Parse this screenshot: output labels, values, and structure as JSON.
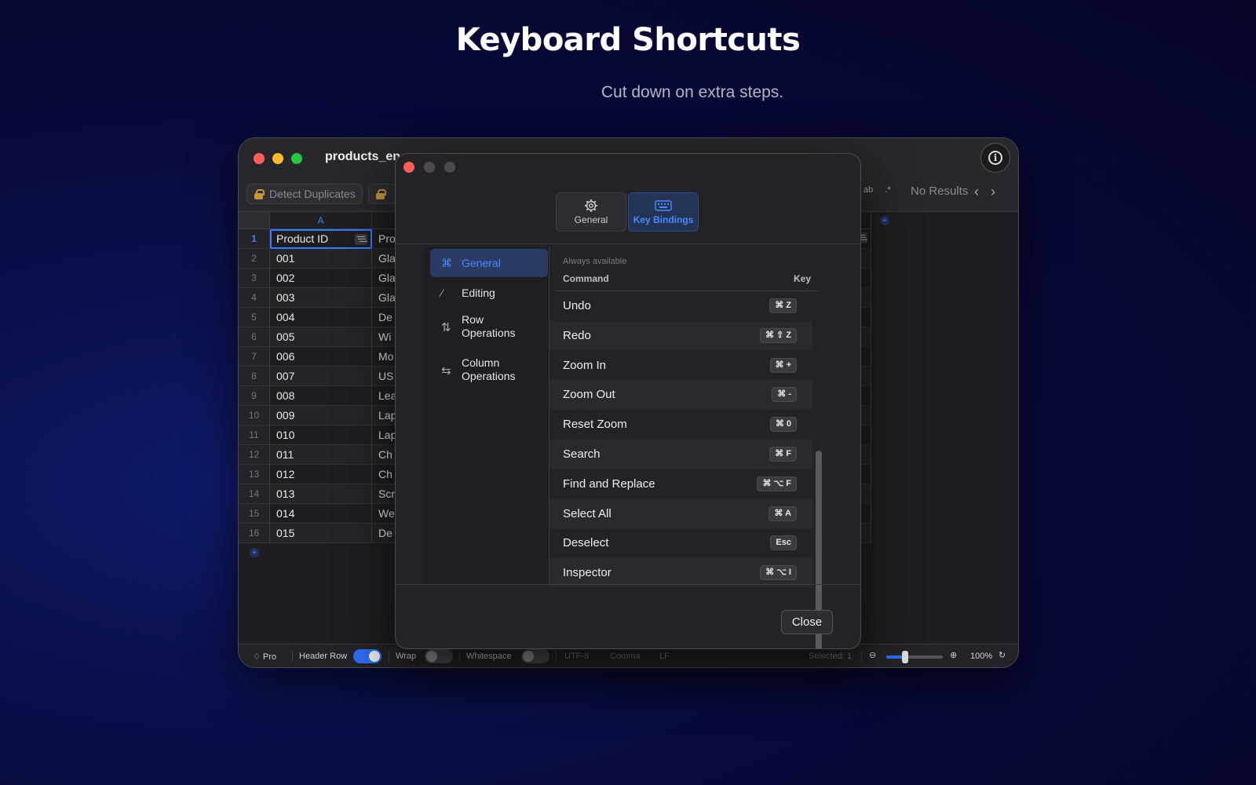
{
  "hero": {
    "title": "Keyboard Shortcuts",
    "subtitle": "Cut down on extra steps."
  },
  "window": {
    "title": "products_en",
    "toolbar": {
      "detect_duplicates": "Detect Duplicates",
      "search_opt_case": "ab",
      "search_opt_regex": ".*",
      "no_results": "No Results"
    },
    "grid": {
      "col_a": "A",
      "header_row": [
        "Product ID",
        "Pro"
      ],
      "row_numbers": [
        "1",
        "2",
        "3",
        "4",
        "5",
        "6",
        "7",
        "8",
        "9",
        "10",
        "11",
        "12",
        "13",
        "14",
        "15",
        "16"
      ],
      "ids": [
        "001",
        "002",
        "003",
        "004",
        "005",
        "006",
        "007",
        "008",
        "009",
        "010",
        "011",
        "012",
        "013",
        "014",
        "015"
      ],
      "col_b": [
        "Gla",
        "Gla",
        "Gla",
        "De",
        "Wi",
        "Mo",
        "US",
        "Lea",
        "Lap",
        "Lap",
        "Ch",
        "Ch",
        "Scr",
        "We",
        "De"
      ]
    },
    "statusbar": {
      "pro": "Pro",
      "header_row": "Header Row",
      "header_row_on": true,
      "wrap": "Wrap",
      "wrap_on": false,
      "whitespace": "Whitespace",
      "whitespace_on": false,
      "encoding": "UTF-8",
      "delimiter": "Comma",
      "line_ending": "LF",
      "selected": "Selected: 1",
      "zoom": "100%",
      "zoom_slider_fraction": 0.33
    }
  },
  "dialog": {
    "tabs": [
      {
        "label": "General",
        "icon": "gear-icon",
        "active": false
      },
      {
        "label": "Key Bindings",
        "icon": "keyboard-icon",
        "active": true
      }
    ],
    "sidebar": [
      {
        "label": "General",
        "icon": "command-icon",
        "glyph": "⌘",
        "active": true
      },
      {
        "label": "Editing",
        "icon": "pencil-icon",
        "glyph": "∕",
        "active": false
      },
      {
        "label": "Row Operations",
        "label_line1": "Row",
        "label_line2": "Operations",
        "icon": "vertical-arrows-icon",
        "glyph": "⇅",
        "active": false
      },
      {
        "label": "Column Operations",
        "label_line1": "Column",
        "label_line2": "Operations",
        "icon": "horizontal-arrows-icon",
        "glyph": "⇆",
        "active": false
      }
    ],
    "section_label": "Always available",
    "column_command": "Command",
    "column_key": "Key",
    "bindings": [
      {
        "command": "Undo",
        "key": "⌘ Z"
      },
      {
        "command": "Redo",
        "key": "⌘ ⇧ Z"
      },
      {
        "command": "Zoom In",
        "key": "⌘ +"
      },
      {
        "command": "Zoom Out",
        "key": "⌘ -"
      },
      {
        "command": "Reset Zoom",
        "key": "⌘ 0"
      },
      {
        "command": "Search",
        "key": "⌘ F"
      },
      {
        "command": "Find and Replace",
        "key": "⌘ ⌥ F"
      },
      {
        "command": "Select All",
        "key": "⌘ A"
      },
      {
        "command": "Deselect",
        "key": "Esc"
      },
      {
        "command": "Inspector",
        "key": "⌘ ⌥ I"
      }
    ],
    "close_label": "Close"
  }
}
